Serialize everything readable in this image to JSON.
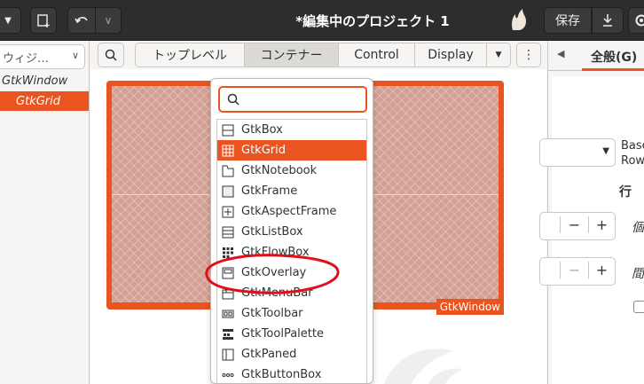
{
  "header": {
    "title": "*編集中のプロジェクト 1",
    "save_label": "保存",
    "undo_icon": "undo-icon",
    "redo_icon": "redo-icon"
  },
  "left_panel": {
    "combo_text": "ウィジ…",
    "tree": [
      {
        "label": "GtkWindow",
        "selected": false
      },
      {
        "label": "GtkGrid",
        "selected": true
      }
    ]
  },
  "toolbar": {
    "tabs": [
      "トップレベル",
      "コンテナー",
      "Control",
      "Display"
    ],
    "active_tab": "コンテナー"
  },
  "canvas": {
    "window_label": "GtkWindow"
  },
  "popover": {
    "search_value": "",
    "items": [
      {
        "label": "GtkBox",
        "icon": "box-icon",
        "selected": false
      },
      {
        "label": "GtkGrid",
        "icon": "grid-icon",
        "selected": true
      },
      {
        "label": "GtkNotebook",
        "icon": "notebook-icon",
        "selected": false
      },
      {
        "label": "GtkFrame",
        "icon": "frame-icon",
        "selected": false
      },
      {
        "label": "GtkAspectFrame",
        "icon": "aspect-frame-icon",
        "selected": false
      },
      {
        "label": "GtkListBox",
        "icon": "list-box-icon",
        "selected": false
      },
      {
        "label": "GtkFlowBox",
        "icon": "flow-box-icon",
        "selected": false
      },
      {
        "label": "GtkOverlay",
        "icon": "overlay-icon",
        "selected": false
      },
      {
        "label": "GtkMenuBar",
        "icon": "menu-bar-icon",
        "selected": false
      },
      {
        "label": "GtkToolbar",
        "icon": "toolbar-icon",
        "selected": false
      },
      {
        "label": "GtkToolPalette",
        "icon": "tool-palette-icon",
        "selected": false
      },
      {
        "label": "GtkPaned",
        "icon": "paned-icon",
        "selected": false
      },
      {
        "label": "GtkButtonBox",
        "icon": "button-box-icon",
        "selected": false
      }
    ]
  },
  "right_panel": {
    "tab_label": "全般(G)",
    "base_text_1": "Base",
    "base_text_2": "Row",
    "row_label": "行",
    "row_value": "",
    "col_value": "",
    "label_ko": "個",
    "label_ma": "間"
  },
  "colors": {
    "accent": "#e95420",
    "header": "#2d2d2d",
    "annotation": "#e0101a"
  }
}
